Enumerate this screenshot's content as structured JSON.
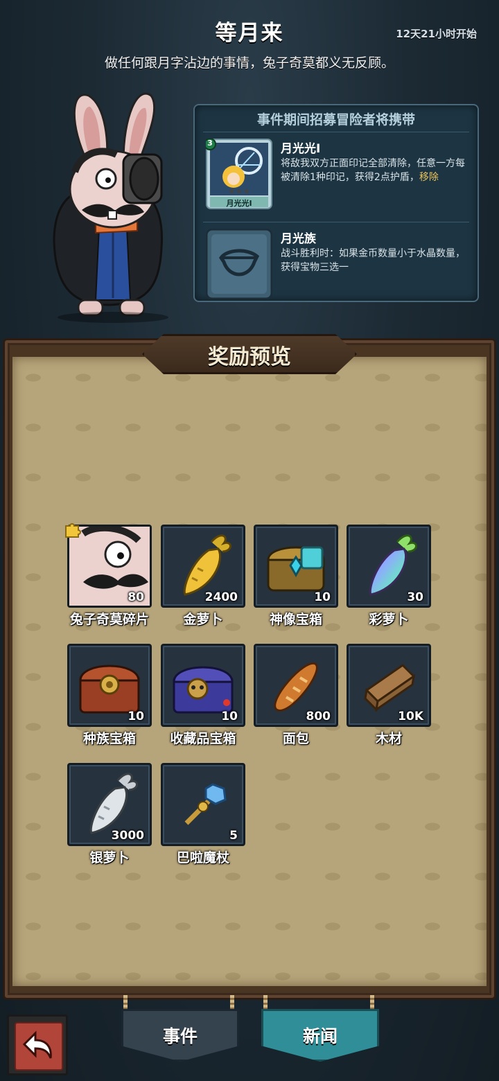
{
  "header": {
    "title": "等月来",
    "countdown": "12天21小时开始",
    "subtitle": "做任何跟月字沾边的事情，兔子奇莫都义无反顾。"
  },
  "carry_panel": {
    "title": "事件期间招募冒险者将携带",
    "items": [
      {
        "name": "月光光Ⅰ",
        "card_label": "月光光Ⅰ",
        "card_level": "3",
        "desc": "将敌我双方正面印记全部清除，任意一方每被清除1种印记，获得2点护盾，",
        "action": "移除"
      },
      {
        "name": "月光族",
        "desc": "战斗胜利时：如果金币数量小于水晶数量，获得宝物三选一"
      }
    ]
  },
  "rewards": {
    "title": "奖励预览",
    "items": [
      {
        "name": "兔子奇莫碎片",
        "qty": "80",
        "icon": "rabbit-fragment-icon"
      },
      {
        "name": "金萝卜",
        "qty": "2400",
        "icon": "gold-carrot-icon"
      },
      {
        "name": "神像宝箱",
        "qty": "10",
        "icon": "idol-chest-icon"
      },
      {
        "name": "彩萝卜",
        "qty": "30",
        "icon": "rainbow-carrot-icon"
      },
      {
        "name": "种族宝箱",
        "qty": "10",
        "icon": "race-chest-icon"
      },
      {
        "name": "收藏品宝箱",
        "qty": "10",
        "icon": "collectible-chest-icon"
      },
      {
        "name": "面包",
        "qty": "800",
        "icon": "bread-icon"
      },
      {
        "name": "木材",
        "qty": "10K",
        "icon": "wood-icon"
      },
      {
        "name": "银萝卜",
        "qty": "3000",
        "icon": "silver-carrot-icon"
      },
      {
        "name": "巴啦魔杖",
        "qty": "5",
        "icon": "magic-wand-icon"
      }
    ]
  },
  "bottom_bar": {
    "back_icon": "back-arrow-icon",
    "tabs": [
      {
        "label": "事件",
        "active": false
      },
      {
        "label": "新闻",
        "active": true
      }
    ]
  },
  "colors": {
    "active_tab": "#2f8e97",
    "inactive_tab": "#35434f",
    "highlight_text": "#e9c25b",
    "board": "#b6a47a"
  }
}
